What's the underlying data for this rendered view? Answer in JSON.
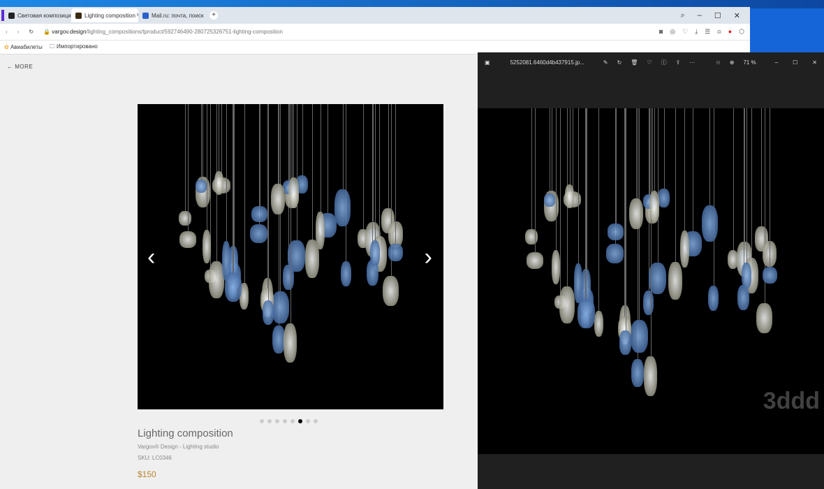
{
  "browser": {
    "tabs": [
      {
        "label": "Световая композиция Vargov"
      },
      {
        "label": "Lighting composition Vargov"
      },
      {
        "label": "Mail.ru: почта, поиск в интернете"
      }
    ],
    "new_tab": "+",
    "url_domain": "vargov.design",
    "url_path": "/lighting_compositions/tproduct/592746490-280725326751-lighting-composition",
    "bookmarks": [
      {
        "label": "Авиабилеты"
      },
      {
        "label": "Импортировано"
      }
    ]
  },
  "page": {
    "back_link": "← MORE",
    "title": "Lighting composition",
    "brand": "Vargov® Design - Lighting studio",
    "sku": "SKU: LC0346",
    "price": "$150",
    "slides_total": 8,
    "active_slide": 6
  },
  "viewer": {
    "filename": "5252081.6460d4b437915.jp...",
    "zoom": "71 %",
    "watermark": "3ddd"
  }
}
